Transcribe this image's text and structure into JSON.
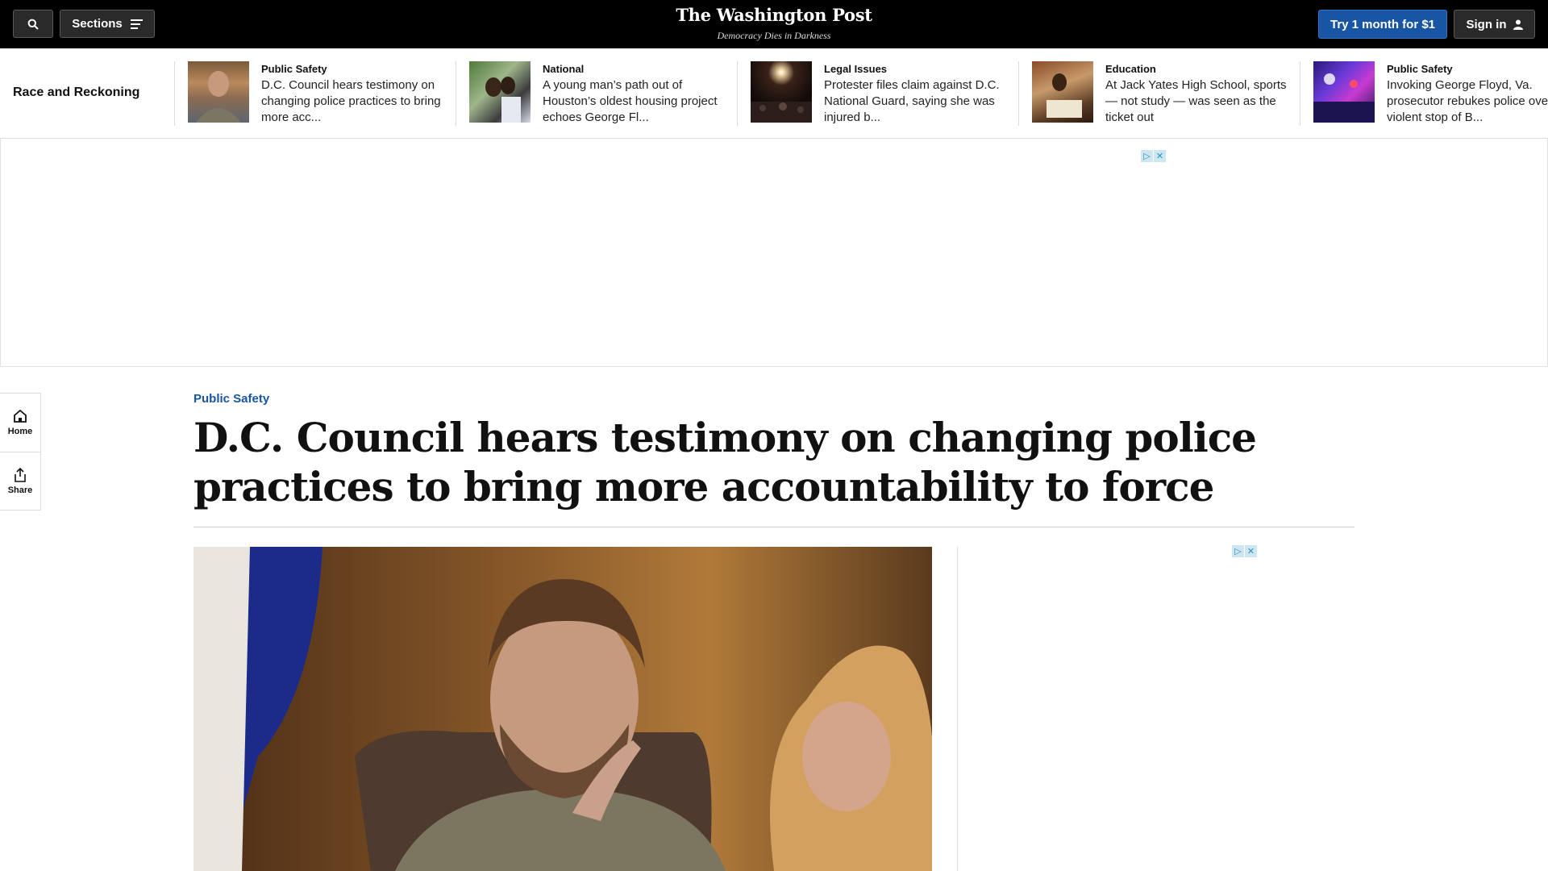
{
  "header": {
    "sections_label": "Sections",
    "logo": "The Washington Post",
    "tagline": "Democracy Dies in Darkness",
    "subscribe_label": "Try 1 month for $1",
    "signin_label": "Sign in",
    "icons": [
      "search-icon",
      "menu-icon",
      "person-icon"
    ]
  },
  "strip": {
    "title": "Race and Reckoning",
    "items": [
      {
        "category": "Public Safety",
        "headline": "D.C. Council hears testimony on changing police practices to bring more acc..."
      },
      {
        "category": "National",
        "headline": "A young man’s path out of Houston’s oldest housing project echoes George Fl..."
      },
      {
        "category": "Legal Issues",
        "headline": "Protester files claim against D.C. National Guard, saying she was injured b..."
      },
      {
        "category": "Education",
        "headline": "At Jack Yates High School, sports — not study — was seen as the ticket out"
      },
      {
        "category": "Public Safety",
        "headline": "Invoking George Floyd, Va. prosecutor rebukes police over violent stop of B..."
      }
    ]
  },
  "rail": {
    "home_label": "Home",
    "share_label": "Share"
  },
  "article": {
    "kicker": "Public Safety",
    "headline": "D.C. Council hears testimony on changing police practices to bring more accountability to force"
  },
  "colors": {
    "accent": "#1955a5",
    "topbar": "#000000"
  }
}
